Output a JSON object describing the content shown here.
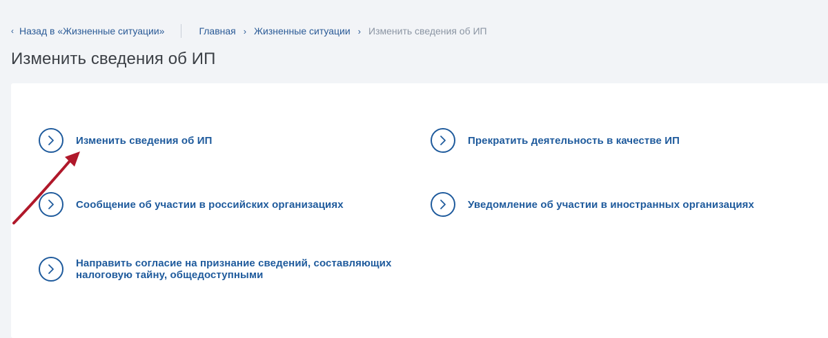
{
  "nav": {
    "back_label": "Назад в «Жизненные ситуации»",
    "breadcrumb": {
      "home": "Главная",
      "section": "Жизненные ситуации",
      "current": "Изменить сведения об ИП"
    }
  },
  "page": {
    "title": "Изменить сведения об ИП"
  },
  "items": [
    {
      "label": "Изменить сведения об ИП"
    },
    {
      "label": "Прекратить деятельность в качестве ИП"
    },
    {
      "label": "Сообщение об участии в российских организациях"
    },
    {
      "label": "Уведомление об участии в иностранных организациях"
    },
    {
      "label": "Направить согласие на признание сведений, составляющих налоговую тайну, общедоступными"
    }
  ],
  "colors": {
    "link": "#2a5a96",
    "item_accent": "#1e5a9c",
    "annotation_arrow": "#b0182a",
    "muted_text": "#8b95a3",
    "title_text": "#3b3f45"
  },
  "icons": {
    "back": "chevron-left-icon",
    "breadcrumb_separator": "chevron-right-icon",
    "item": "circle-chevron-right-icon"
  }
}
